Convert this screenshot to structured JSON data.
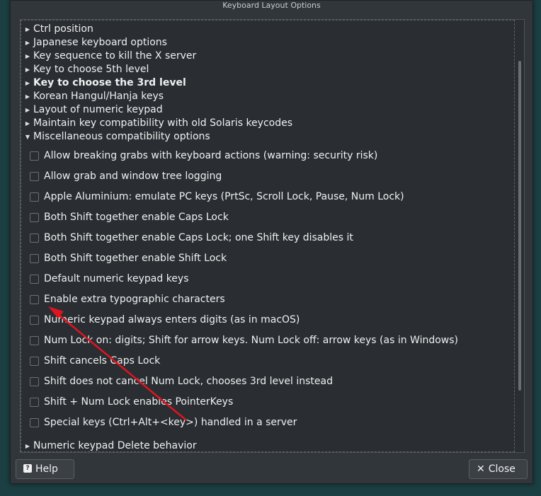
{
  "window": {
    "title": "Keyboard Layout Options"
  },
  "tree": {
    "groups": [
      {
        "label": "Ctrl position",
        "expanded": false,
        "bold": false
      },
      {
        "label": "Japanese keyboard options",
        "expanded": false,
        "bold": false
      },
      {
        "label": "Key sequence to kill the X server",
        "expanded": false,
        "bold": false
      },
      {
        "label": "Key to choose 5th level",
        "expanded": false,
        "bold": false
      },
      {
        "label": "Key to choose the 3rd level",
        "expanded": false,
        "bold": true
      },
      {
        "label": "Korean Hangul/Hanja keys",
        "expanded": false,
        "bold": false
      },
      {
        "label": "Layout of numeric keypad",
        "expanded": false,
        "bold": false
      },
      {
        "label": "Maintain key compatibility with old Solaris keycodes",
        "expanded": false,
        "bold": false
      },
      {
        "label": "Miscellaneous compatibility options",
        "expanded": true,
        "bold": false
      }
    ],
    "options": [
      {
        "label": "Allow breaking grabs with keyboard actions (warning: security risk)",
        "checked": false
      },
      {
        "label": "Allow grab and window tree logging",
        "checked": false
      },
      {
        "label": "Apple Aluminium: emulate PC keys (PrtSc, Scroll Lock, Pause, Num Lock)",
        "checked": false
      },
      {
        "label": "Both Shift together enable Caps Lock",
        "checked": false
      },
      {
        "label": "Both Shift together enable Caps Lock; one Shift key disables it",
        "checked": false
      },
      {
        "label": "Both Shift together enable Shift Lock",
        "checked": false
      },
      {
        "label": "Default numeric keypad keys",
        "checked": false
      },
      {
        "label": "Enable extra typographic characters",
        "checked": false
      },
      {
        "label": "Numeric keypad always enters digits (as in macOS)",
        "checked": false
      },
      {
        "label": "Num Lock on: digits; Shift for arrow keys. Num Lock off: arrow keys (as in Windows)",
        "checked": false
      },
      {
        "label": "Shift cancels Caps Lock",
        "checked": false
      },
      {
        "label": "Shift does not cancel Num Lock, chooses 3rd level instead",
        "checked": false
      },
      {
        "label": "Shift + Num Lock enables PointerKeys",
        "checked": false
      },
      {
        "label": "Special keys (Ctrl+Alt+<key>) handled in a server",
        "checked": false
      }
    ],
    "after": [
      {
        "label": "Numeric keypad Delete behavior",
        "expanded": false,
        "bold": false
      }
    ]
  },
  "buttons": {
    "help": {
      "label": "Help",
      "icon": "help-icon"
    },
    "close": {
      "label": "Close",
      "icon": "close-icon"
    }
  },
  "annotation": {
    "color": "#e0141e",
    "icon": "red-arrow"
  },
  "colors": {
    "background": "#1b3f42",
    "dialog": "#31363b",
    "list": "#2a2e32",
    "text": "#eff0f1"
  }
}
